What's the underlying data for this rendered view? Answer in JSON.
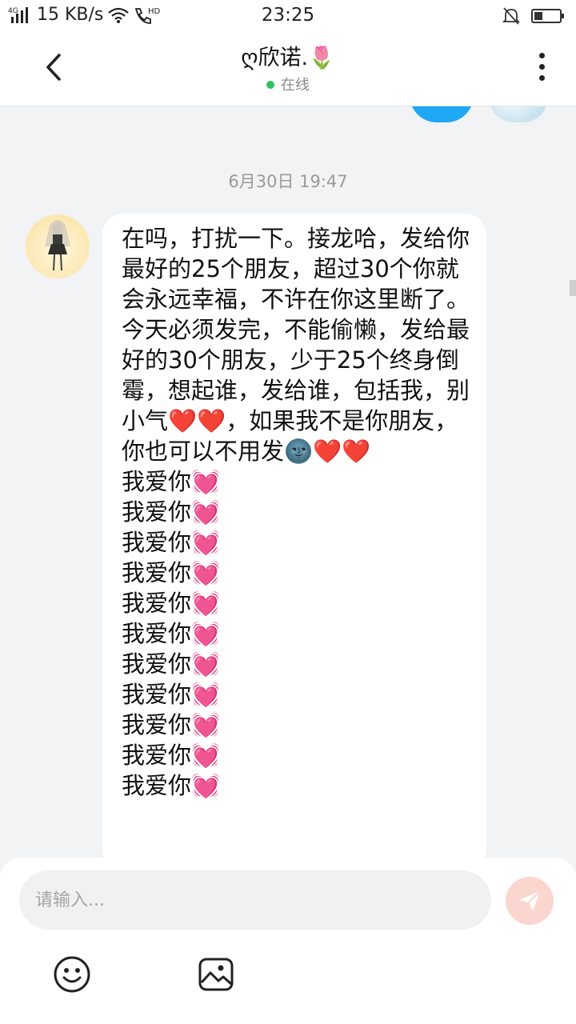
{
  "status_bar": {
    "network_type": "4G",
    "speed": "15 KB/s",
    "call_label": "HD",
    "time": "23:25",
    "icons": [
      "signal-icon",
      "wifi-icon",
      "hd-call-icon",
      "mute-bell-icon",
      "battery-icon"
    ]
  },
  "header": {
    "title": "ღ欣诺.🌷",
    "presence": "在线",
    "presence_color": "#2ec45a"
  },
  "chat": {
    "timestamp": "6月30日 19:47",
    "message": "在吗，打扰一下。接龙哈，发给你最好的25个朋友，超过30个你就会永远幸福，不许在你这里断了。\n今天必须发完，不能偷懒，发给最好的30个朋友，少于25个终身倒霉，想起谁，发给谁，包括我，别小气❤️❤️，如果我不是你朋友，你也可以不用发🌚❤️❤️\n我爱你💓\n我爱你💓\n我爱你💓\n我爱你💓\n我爱你💓\n我爱你💓\n我爱你💓\n我爱你💓\n我爱你💓\n我爱你💓\n我爱你💓"
  },
  "composer": {
    "placeholder": "请输入...",
    "send_color": "#fbd6cf",
    "tools": [
      "emoji-icon",
      "image-icon"
    ]
  },
  "colors": {
    "accent_blue": "#1ea7f3",
    "background": "#f2f3f5"
  }
}
